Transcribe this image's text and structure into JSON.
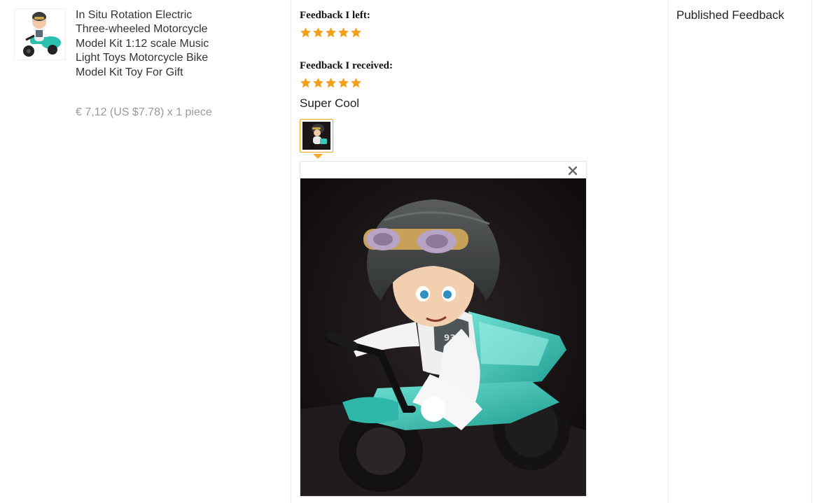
{
  "product": {
    "title": "In Situ Rotation Electric Three-wheeled Motorcycle Model Kit 1:12 scale Music Light Toys Motorcycle Bike Model Kit Toy For Gift",
    "price_line": "€ 7,12 (US $7.78) x 1 piece"
  },
  "feedback": {
    "left_label": "Feedback I left:",
    "left_rating": 5,
    "received_label": "Feedback I received:",
    "received_rating": 5,
    "comment": "Super Cool",
    "star_color": "#f5a01a"
  },
  "viewer": {
    "close_icon": "close-icon"
  },
  "status": {
    "published": "Published Feedback"
  }
}
